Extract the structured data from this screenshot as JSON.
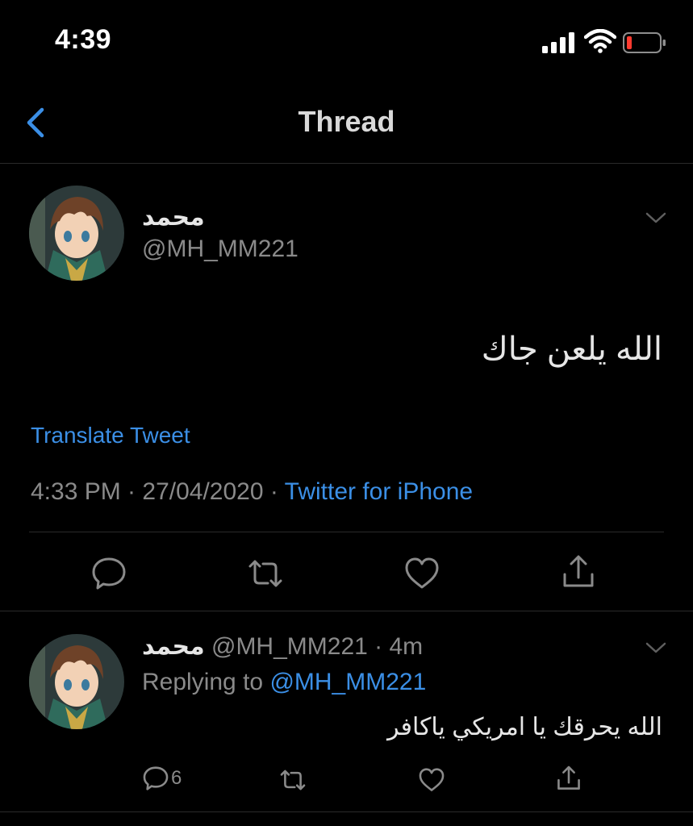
{
  "status_bar": {
    "time": "4:39"
  },
  "nav": {
    "title": "Thread"
  },
  "main_tweet": {
    "name": "محمد",
    "handle": "@MH_MM221",
    "text": "الله يلعن جاك",
    "translate": "Translate Tweet",
    "timestamp": "4:33 PM · 27/04/2020 · ",
    "source": "Twitter for iPhone"
  },
  "reply": {
    "name": "محمد",
    "handle_time": "@MH_MM221 · 4m",
    "replying_prefix": "Replying to ",
    "replying_handle": "@MH_MM221",
    "text": "الله يحرقك يا امريكي ياكافر",
    "reply_count": "6"
  },
  "colors": {
    "accent": "#3b8fe6",
    "background": "#000000",
    "divider": "#2a2a2a",
    "battery_low": "#ff3b30"
  },
  "icons": [
    "signal-icon",
    "wifi-icon",
    "battery-icon",
    "back-chevron-icon",
    "reply-icon",
    "retweet-icon",
    "like-icon",
    "share-icon",
    "chevron-down-icon"
  ]
}
